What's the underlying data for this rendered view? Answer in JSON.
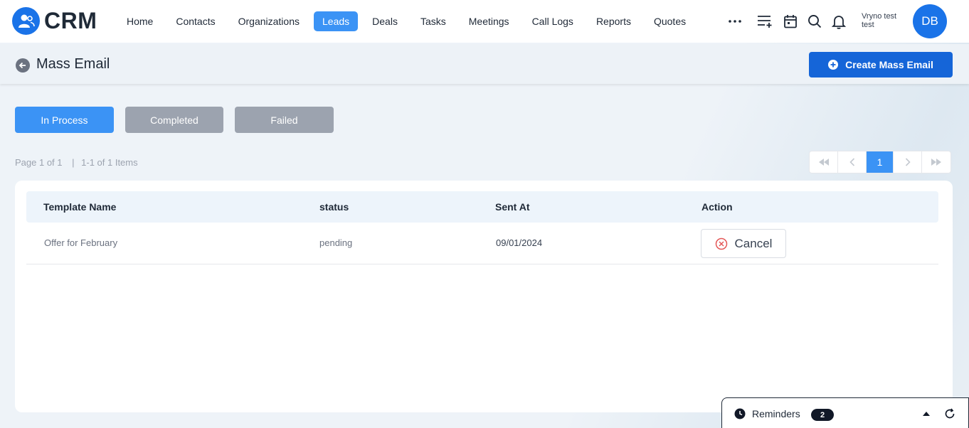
{
  "brand": {
    "name": "CRM"
  },
  "nav": {
    "items": [
      {
        "label": "Home"
      },
      {
        "label": "Contacts"
      },
      {
        "label": "Organizations"
      },
      {
        "label": "Leads"
      },
      {
        "label": "Deals"
      },
      {
        "label": "Tasks"
      },
      {
        "label": "Meetings"
      },
      {
        "label": "Call Logs"
      },
      {
        "label": "Reports"
      },
      {
        "label": "Quotes"
      }
    ],
    "active": "Leads",
    "more_icon": "more-horizontal-icon",
    "tool_icons": [
      "add-list-icon",
      "calendar-icon",
      "search-icon",
      "bell-icon"
    ]
  },
  "user": {
    "name_line1": "Vryno test",
    "name_line2": "test",
    "initials": "DB"
  },
  "header": {
    "title": "Mass Email",
    "create_label": "Create Mass Email"
  },
  "tabs": [
    {
      "label": "In Process",
      "active": true
    },
    {
      "label": "Completed",
      "active": false
    },
    {
      "label": "Failed",
      "active": false
    }
  ],
  "pagination": {
    "page_text": "Page 1 of 1",
    "items_text": "1-1 of 1 Items",
    "separator": "|",
    "current_page": "1"
  },
  "table": {
    "columns": [
      "Template Name",
      "status",
      "Sent At",
      "Action"
    ],
    "rows": [
      {
        "template_name": "Offer for February",
        "status": "pending",
        "sent_at": "09/01/2024",
        "action_label": "Cancel"
      }
    ]
  },
  "reminders": {
    "label": "Reminders",
    "count": "2"
  },
  "colors": {
    "primary": "#1565d8",
    "accent": "#3b93f5",
    "tab_inactive": "#9ca3af",
    "cancel_icon": "#e45757"
  }
}
